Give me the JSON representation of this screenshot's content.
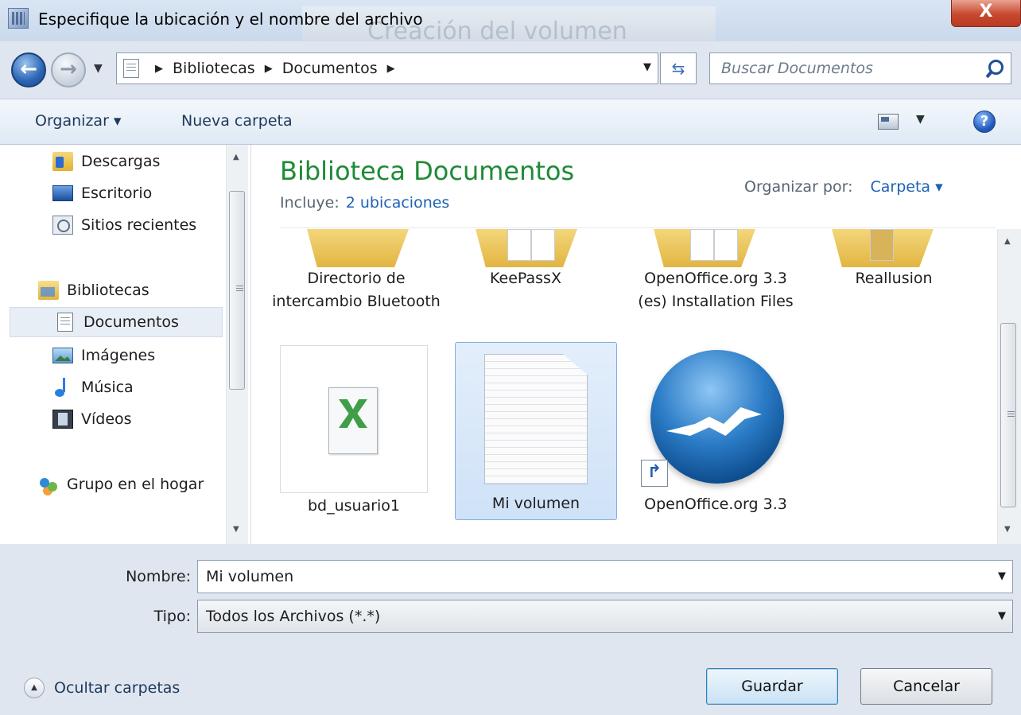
{
  "window": {
    "title": "Especifique la ubicación y el nombre del archivo",
    "background_title": "Creación del volumen",
    "close_label": "X"
  },
  "address": {
    "crumbs": [
      "Bibliotecas",
      "Documentos"
    ],
    "search_placeholder": "Buscar Documentos"
  },
  "toolbar": {
    "organize_label": "Organizar ▾",
    "new_folder_label": "Nueva carpeta",
    "help_label": "?"
  },
  "nav": {
    "items": [
      {
        "label": "Descargas",
        "icon": "downloads-folder-icon"
      },
      {
        "label": "Escritorio",
        "icon": "desktop-icon"
      },
      {
        "label": "Sitios recientes",
        "icon": "recent-places-icon"
      },
      {
        "label": "Bibliotecas",
        "icon": "libraries-icon"
      },
      {
        "label": "Documentos",
        "icon": "documents-icon",
        "selected": true
      },
      {
        "label": "Imágenes",
        "icon": "pictures-icon"
      },
      {
        "label": "Música",
        "icon": "music-icon"
      },
      {
        "label": "Vídeos",
        "icon": "videos-icon"
      },
      {
        "label": "Grupo en el hogar",
        "icon": "homegroup-icon"
      }
    ]
  },
  "content": {
    "library_title": "Biblioteca Documentos",
    "includes_label": "Incluye:",
    "includes_link": "2 ubicaciones",
    "arrange_label": "Organizar por:",
    "arrange_value": "Carpeta ▾",
    "items": [
      {
        "name": "Directorio de intercambio Bluetooth",
        "type": "folder"
      },
      {
        "name": "KeePassX",
        "type": "folder"
      },
      {
        "name": "OpenOffice.org 3.3 (es) Installation Files",
        "type": "folder"
      },
      {
        "name": "Reallusion",
        "type": "folder"
      },
      {
        "name": "bd_usuario1",
        "type": "file"
      },
      {
        "name": "Mi volumen",
        "type": "file",
        "selected": true
      },
      {
        "name": "OpenOffice.org 3.3",
        "type": "shortcut"
      }
    ]
  },
  "form": {
    "name_label": "Nombre:",
    "name_value": "Mi volumen",
    "type_label": "Tipo:",
    "type_value": "Todos los Archivos (*.*)"
  },
  "footer": {
    "hide_folders_label": "Ocultar carpetas",
    "save_label": "Guardar",
    "cancel_label": "Cancelar"
  }
}
